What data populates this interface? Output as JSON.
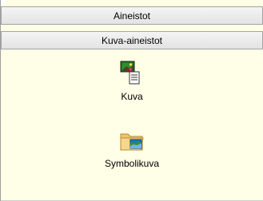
{
  "groups": [
    {
      "label": "Aineistot"
    },
    {
      "label": "Kuva-aineistot"
    }
  ],
  "items": [
    {
      "label": "Kuva",
      "icon": "image-document-icon"
    },
    {
      "label": "Symbolikuva",
      "icon": "folder-image-icon"
    }
  ],
  "colors": {
    "panel_background": "#fffee6",
    "bar_border": "#a3a3a3"
  }
}
